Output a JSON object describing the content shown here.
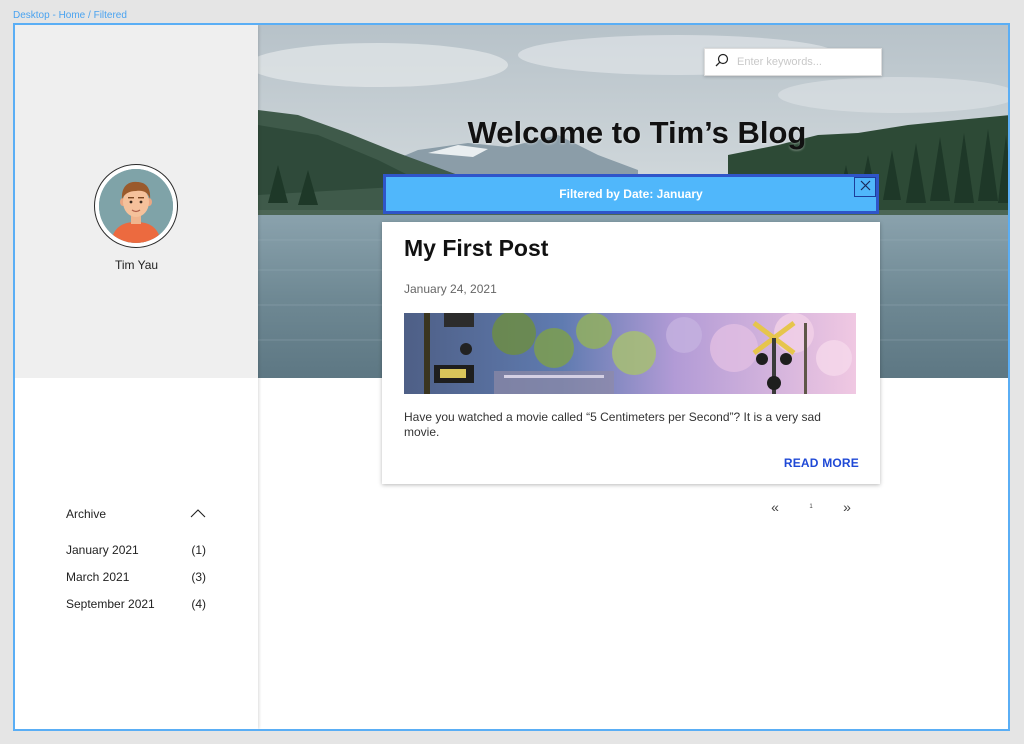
{
  "frame": {
    "label": "Desktop - Home / Filtered"
  },
  "colors": {
    "frame_border": "#5aaef5",
    "filter_banner_bg": "#50b7fb",
    "filter_banner_border": "#2f55c9",
    "read_more": "#1f49d6",
    "sidebar_profile_bg": "#efefef"
  },
  "sidebar": {
    "profile": {
      "name": "Tim Yau",
      "avatar_icon": "user-avatar-icon"
    },
    "archive": {
      "title": "Archive",
      "toggle_icon": "chevron-up-icon",
      "items": [
        {
          "label": "January 2021",
          "count": "(1)"
        },
        {
          "label": "March 2021",
          "count": "(3)"
        },
        {
          "label": "September 2021",
          "count": "(4)"
        }
      ]
    }
  },
  "header": {
    "title": "Welcome to Tim’s Blog",
    "search": {
      "placeholder": "Enter keywords...",
      "value": "",
      "icon": "search-icon"
    }
  },
  "filter": {
    "text": "Filtered by Date: January",
    "close_icon": "close-icon"
  },
  "post": {
    "title": "My First Post",
    "date": "January 24, 2021",
    "excerpt": "Have you watched a movie called “5 Centimeters per Second”? It is a very sad movie.",
    "read_more": "READ MORE"
  },
  "pagination": {
    "prev": "«",
    "current": "1",
    "next": "»"
  }
}
